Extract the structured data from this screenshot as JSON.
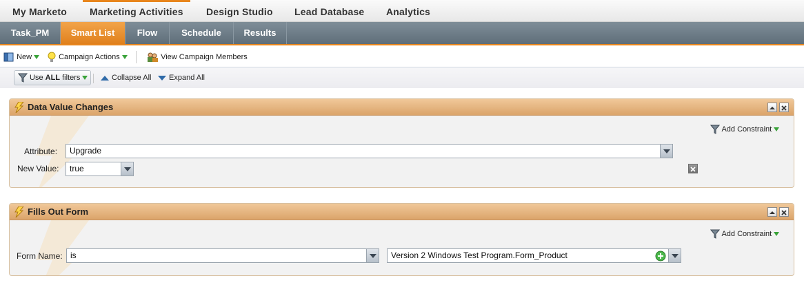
{
  "topnav": {
    "items": [
      "My Marketo",
      "Marketing Activities",
      "Design Studio",
      "Lead Database",
      "Analytics"
    ],
    "active_index": 1
  },
  "subtabs": {
    "items": [
      "Task_PM",
      "Smart List",
      "Flow",
      "Schedule",
      "Results"
    ],
    "active_index": 1
  },
  "toolbar": {
    "new_label": "New",
    "campaign_actions_label": "Campaign Actions",
    "view_members_label": "View Campaign Members"
  },
  "filterbar": {
    "use_all_prefix": "Use",
    "use_all_bold": "ALL",
    "use_all_suffix": "filters",
    "collapse_label": "Collapse All",
    "expand_label": "Expand All"
  },
  "filters": [
    {
      "title": "Data Value Changes",
      "add_constraint_label": "Add Constraint",
      "rows": [
        {
          "label": "Attribute:",
          "value": "Upgrade"
        },
        {
          "label": "New Value:",
          "value": "true"
        }
      ]
    },
    {
      "title": "Fills Out Form",
      "add_constraint_label": "Add Constraint",
      "rows": [
        {
          "label": "Form Name:",
          "operator": "is",
          "value": "Version 2 Windows Test Program.Form_Product"
        }
      ]
    }
  ],
  "colors": {
    "accent_orange": "#e8851c",
    "subtab_bar": "#6b7a85",
    "panel_header": "#e3b07a"
  }
}
